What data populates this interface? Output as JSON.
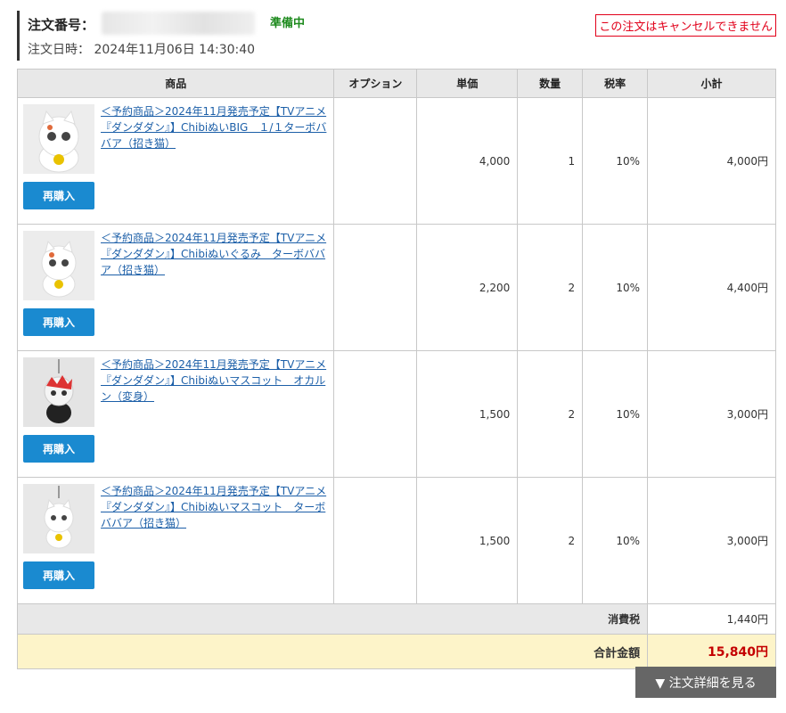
{
  "order": {
    "number_label": "注文番号：",
    "status": "準備中",
    "date_text": "注文日時： 2024年11月06日 14:30:40",
    "cancel_note": "この注文はキャンセルできません"
  },
  "table": {
    "headers": [
      "商品",
      "オプション",
      "単価",
      "数量",
      "税率",
      "小計"
    ],
    "rows": [
      {
        "name": "＜予約商品＞2024年11月発売予定【TVアニメ『ダンダダン』】ChibiぬいBIG　１/１ターボババア（招き猫）",
        "option": "",
        "unit_price": "4,000",
        "qty": "1",
        "tax_rate": "10%",
        "subtotal": "4,000円",
        "rebuy": "再購入"
      },
      {
        "name": "＜予約商品＞2024年11月発売予定【TVアニメ『ダンダダン』】Chibiぬいぐるみ　ターボババア（招き猫）",
        "option": "",
        "unit_price": "2,200",
        "qty": "2",
        "tax_rate": "10%",
        "subtotal": "4,400円",
        "rebuy": "再購入"
      },
      {
        "name": "＜予約商品＞2024年11月発売予定【TVアニメ『ダンダダン』】Chibiぬいマスコット　オカルン（変身）",
        "option": "",
        "unit_price": "1,500",
        "qty": "2",
        "tax_rate": "10%",
        "subtotal": "3,000円",
        "rebuy": "再購入"
      },
      {
        "name": "＜予約商品＞2024年11月発売予定【TVアニメ『ダンダダン』】Chibiぬいマスコット　ターボババア（招き猫）",
        "option": "",
        "unit_price": "1,500",
        "qty": "2",
        "tax_rate": "10%",
        "subtotal": "3,000円",
        "rebuy": "再購入"
      }
    ],
    "tax_label": "消費税",
    "tax_value": "1,440円",
    "total_label": "合計金額",
    "total_value": "15,840円"
  },
  "detail_button": "▼ 注文詳細を見る",
  "colors": {
    "accent": "#1a8ad0",
    "status": "#1d8a1d",
    "warning": "#e1001a",
    "total_bg": "#fdf4c9",
    "total_value": "#c40000"
  }
}
